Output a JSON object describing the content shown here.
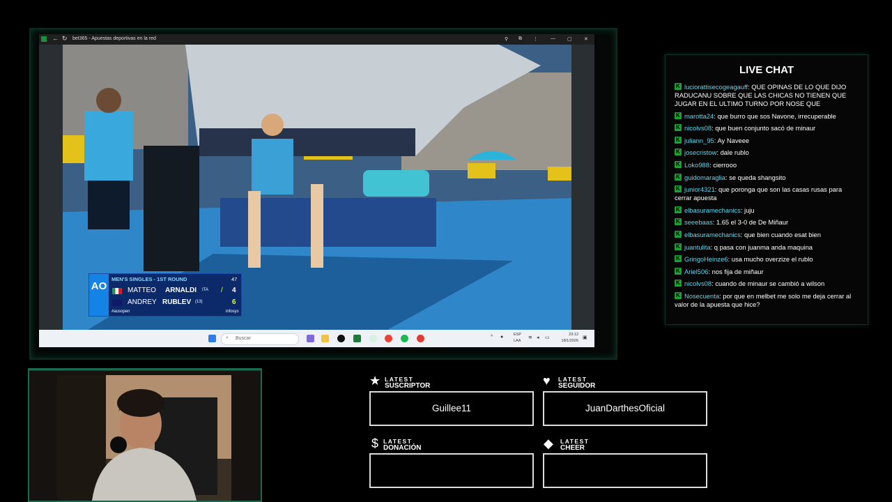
{
  "browser": {
    "title": "bet365 - Apuestas deportivas en la red"
  },
  "scoreboard": {
    "round": "MEN'S SINGLES - 1ST ROUND",
    "time": "47",
    "player1": {
      "first": "MATTEO",
      "last": "ARNALDI",
      "country": "ITA",
      "games": "4"
    },
    "player2": {
      "first": "ANDREY",
      "last": "RUBLEV",
      "seed": "(13)",
      "games": "6"
    },
    "hashtag": "#ausopen",
    "sponsor": "infosys",
    "event_logo": "AO"
  },
  "taskbar": {
    "search_placeholder": "Buscar",
    "lang": "ESP",
    "layout": "LAA",
    "time": "23:12",
    "date": "18/1/2026"
  },
  "chat": {
    "title": "LIVE CHAT",
    "messages": [
      {
        "user": "luciorattisecogeagauff",
        "text": "QUE OPINAS DE LO QUE DIJO RADUCANU SOBRE QUE LAS CHICAS NO TIENEN QUE JUGAR EN EL ULTIMO TURNO POR NOSE QUE"
      },
      {
        "user": "marotta24",
        "text": "que burro que sos Navone, irrecuperable"
      },
      {
        "user": "nicolvs08",
        "text": "que buen conjunto sacó de minaur"
      },
      {
        "user": "juliann_95",
        "text": "Ay Naveee"
      },
      {
        "user": "josecristow",
        "text": "dale rublo"
      },
      {
        "user": "Loko988",
        "text": "cierrooo"
      },
      {
        "user": "guidomaraglia",
        "text": "se queda shangsito"
      },
      {
        "user": "junior4321",
        "text": "que poronga que son las casas rusas para cerrar apuesta"
      },
      {
        "user": "elbasuramechanics",
        "text": "juju"
      },
      {
        "user": "seeebaas",
        "text": "1.65 el 3-0 de De Miñaur"
      },
      {
        "user": "elbasuramechanics",
        "text": "que bien cuando esat bien"
      },
      {
        "user": "juantulita",
        "text": "q pasa con juanma anda maquina"
      },
      {
        "user": "GringoHeinze6",
        "text": "usa mucho overzize el rublo"
      },
      {
        "user": "Ariel506",
        "text": "nos fija de miñaur"
      },
      {
        "user": "nicolvs08",
        "text": "cuando de minaur se cambió a wilson"
      },
      {
        "user": "Nosecuenta",
        "text": "por que en melbet me solo me deja cerrar al valor de la apuesta que hice?"
      }
    ]
  },
  "events": {
    "subscriber": {
      "label_top": "LATEST",
      "label": "SUSCRIPTOR",
      "value": "Guillee11",
      "icon": "star-icon"
    },
    "follower": {
      "label_top": "LATEST",
      "label": "SEGUIDOR",
      "value": "JuanDarthesOficial",
      "icon": "heart-icon"
    },
    "donation": {
      "label_top": "LATEST",
      "label": "DONACIÓN",
      "value": "",
      "icon": "dollar-icon"
    },
    "cheer": {
      "label_top": "LATEST",
      "label": "CHEER",
      "value": "",
      "icon": "diamond-icon"
    }
  },
  "colors": {
    "accent": "#1b6a50",
    "chat_user": "#5fd8ef",
    "badge": "#1fa032"
  }
}
